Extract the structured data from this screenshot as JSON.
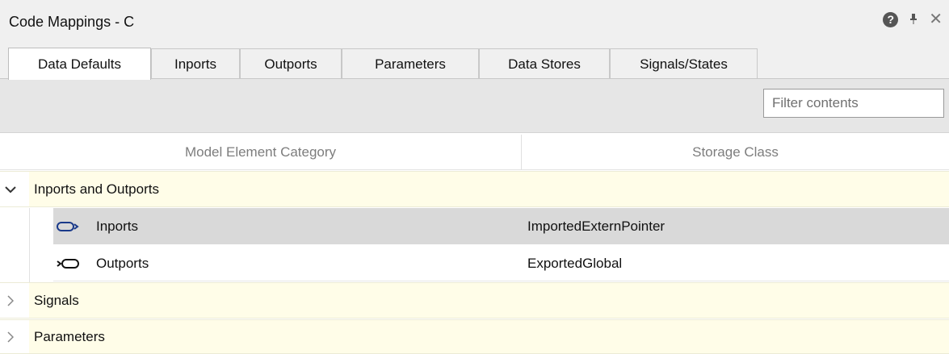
{
  "window": {
    "title": "Code Mappings - C"
  },
  "tabs": [
    {
      "label": "Data Defaults",
      "active": true
    },
    {
      "label": "Inports",
      "active": false
    },
    {
      "label": "Outports",
      "active": false
    },
    {
      "label": "Parameters",
      "active": false
    },
    {
      "label": "Data Stores",
      "active": false
    },
    {
      "label": "Signals/States",
      "active": false
    }
  ],
  "toolbar": {
    "filter_placeholder": "Filter contents",
    "filter_value": ""
  },
  "table": {
    "columns": [
      "Model Element Category",
      "Storage Class"
    ],
    "groups": [
      {
        "label": "Inports and Outports",
        "expanded": true,
        "items": [
          {
            "name": "Inports",
            "storage_class": "ImportedExternPointer",
            "icon": "inport-icon",
            "selected": true
          },
          {
            "name": "Outports",
            "storage_class": "ExportedGlobal",
            "icon": "outport-icon",
            "selected": false
          }
        ]
      },
      {
        "label": "Signals",
        "expanded": false
      },
      {
        "label": "Parameters",
        "expanded": false
      }
    ]
  },
  "colors": {
    "group_background": "#fffde8",
    "selected_row": "#d9d9d9",
    "toolbar_background": "#e6e6e6",
    "header_text": "#7d7d7d"
  }
}
